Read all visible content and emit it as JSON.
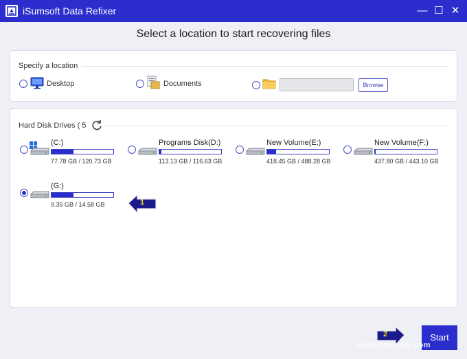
{
  "window": {
    "title": "iSumsoft Data Refixer",
    "controls": [
      "—",
      "☐",
      "✕"
    ]
  },
  "heading": "Select a location to start recovering files",
  "location": {
    "section_label": "Specify a location",
    "options": [
      {
        "label": "Desktop",
        "icon": "desktop-icon",
        "selected": false
      },
      {
        "label": "Documents",
        "icon": "documents-icon",
        "selected": false
      },
      {
        "label": "",
        "icon": "folder-icon",
        "selected": false
      }
    ],
    "path_value": "",
    "browse_label": "Browse"
  },
  "drives": {
    "section_label": "Hard Disk Drives ( 5 )",
    "refresh_icon": "refresh-icon",
    "list": [
      {
        "name": "(C:)",
        "size": "77.78 GB / 120.73 GB",
        "used_fraction": 0.36,
        "selected": false,
        "system": true
      },
      {
        "name": "Programs Disk(D:)",
        "size": "113.13 GB / 116.63 GB",
        "used_fraction": 0.03,
        "selected": false,
        "system": false
      },
      {
        "name": "New Volume(E:)",
        "size": "418.45 GB / 488.28 GB",
        "used_fraction": 0.14,
        "selected": false,
        "system": false
      },
      {
        "name": "New Volume(F:)",
        "size": "437.80 GB / 443.10 GB",
        "used_fraction": 0.01,
        "selected": false,
        "system": false
      },
      {
        "name": "(G:)",
        "size": "9.35 GB / 14.58 GB",
        "used_fraction": 0.36,
        "selected": true,
        "system": false
      }
    ]
  },
  "callouts": [
    {
      "number": "1"
    },
    {
      "number": "2"
    }
  ],
  "start_label": "Start",
  "watermark": "shoumaxieshi.com",
  "colors": {
    "accent": "#2b2ecc",
    "callout_fill": "#1a1a8c",
    "callout_text": "#f5e400",
    "background": "#eef0f6"
  }
}
